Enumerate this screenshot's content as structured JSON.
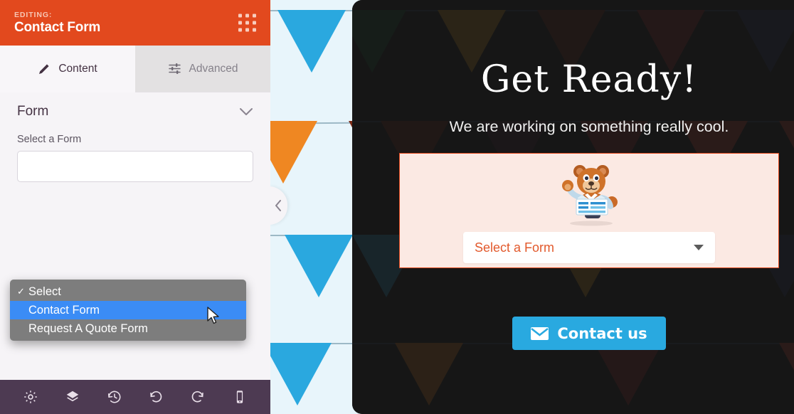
{
  "sidebar": {
    "header": {
      "editing_label": "EDITING:",
      "title": "Contact Form",
      "grid_icon": "grid-dots-icon"
    },
    "tabs": [
      {
        "label": "Content",
        "icon": "pencil-icon",
        "active": true
      },
      {
        "label": "Advanced",
        "icon": "sliders-icon",
        "active": false
      }
    ],
    "section": {
      "title": "Form",
      "collapse_icon": "chevron-down-icon"
    },
    "field": {
      "label": "Select a Form",
      "value": ""
    },
    "dropdown": {
      "open": true,
      "options": [
        {
          "label": "Select",
          "checked": true,
          "highlighted": false
        },
        {
          "label": "Contact Form",
          "checked": false,
          "highlighted": true
        },
        {
          "label": "Request A Quote Form",
          "checked": false,
          "highlighted": false
        }
      ]
    },
    "footer_tools": [
      {
        "name": "settings-gear-icon",
        "label": "Settings"
      },
      {
        "name": "layers-icon",
        "label": "Layers"
      },
      {
        "name": "history-icon",
        "label": "Revision History"
      },
      {
        "name": "undo-icon",
        "label": "Undo"
      },
      {
        "name": "redo-icon",
        "label": "Redo"
      },
      {
        "name": "mobile-device-icon",
        "label": "Mobile Preview"
      }
    ]
  },
  "canvas": {
    "collapse_icon": "chevron-left-icon",
    "background": "bunting-pennants"
  },
  "preview": {
    "headline": "Get Ready!",
    "subheadline": "We are working on something really cool.",
    "mascot": "waving-bear-mascot-icon",
    "form_select": {
      "value": "Select a Form",
      "caret_icon": "caret-down-icon"
    },
    "cta": {
      "label": "Contact us",
      "icon": "envelope-icon"
    }
  },
  "colors": {
    "brand_orange": "#e2491e",
    "toolbar_purple": "#4d3a52",
    "sidebar_bg": "#f6f4f7",
    "canvas_blue": "#e8f5fb",
    "cta_blue": "#29a9e0",
    "card_bg": "#fbe9e3",
    "highlight_blue": "#3b8cf5",
    "dropdown_gray": "#7d7d7d",
    "overlay_dark": "#1c1c1c"
  }
}
